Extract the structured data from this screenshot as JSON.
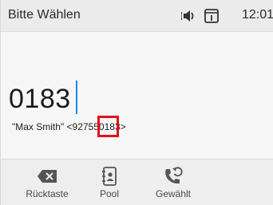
{
  "status_bar": {
    "title": "Bitte Wählen",
    "time": "12:01",
    "icons": [
      "speaker-icon",
      "tablet-icon"
    ]
  },
  "dialer": {
    "number": "0183",
    "suggestion_prefix": "\"Max Smith\" <92755",
    "suggestion_match": "0183",
    "suggestion_suffix": ">",
    "highlight_color": "#e0121a",
    "cursor_color": "#1e88e5"
  },
  "softkeys": [
    {
      "label": "Rücktaste",
      "icon": "backspace-icon"
    },
    {
      "label": "Pool",
      "icon": "directory-icon"
    },
    {
      "label": "Gewählt",
      "icon": "redial-icon"
    }
  ]
}
